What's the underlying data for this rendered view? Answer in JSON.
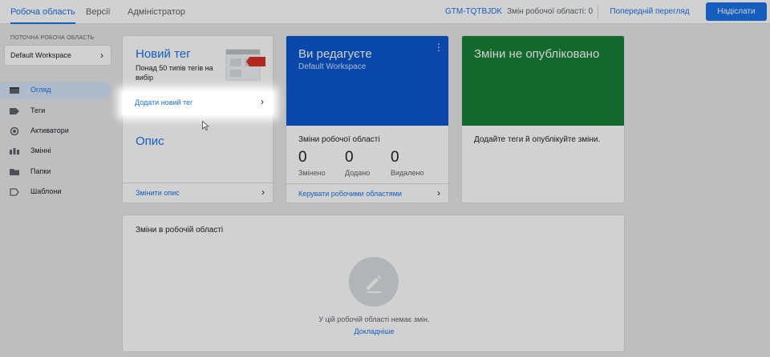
{
  "topbar": {
    "tabs": [
      "Робоча область",
      "Версії",
      "Адміністратор"
    ],
    "container_id": "GTM-TQTBJDK",
    "ws_changes": "Змін робочої області: 0",
    "preview_label": "Попередній перегляд",
    "submit_label": "Надіслати"
  },
  "sidebar": {
    "ws_label": "ПОТОЧНА РОБОЧА ОБЛАСТЬ",
    "ws_name": "Default Workspace",
    "items": [
      "Огляд",
      "Теги",
      "Активатори",
      "Змінні",
      "Папки",
      "Шаблони"
    ]
  },
  "new_tag": {
    "title": "Новий тег",
    "desc": "Понад 50 типів тегів на вибір",
    "add_label": "Додати новий тег"
  },
  "description": {
    "title": "Опис",
    "edit_label": "Змінити опис"
  },
  "editing": {
    "title": "Ви редагуєте",
    "workspace": "Default Workspace",
    "changes_title": "Зміни робочої області",
    "stats": [
      {
        "value": "0",
        "label": "Змінено"
      },
      {
        "value": "0",
        "label": "Додано"
      },
      {
        "value": "0",
        "label": "Видалено"
      }
    ],
    "manage_label": "Керувати робочими областями"
  },
  "unpublished": {
    "title": "Зміни не опубліковано",
    "text": "Додайте теги й опублікуйте зміни."
  },
  "ws_changes_panel": {
    "title": "Зміни в робочій області",
    "empty_text": "У цій робочій області немає змін.",
    "learn_more": "Докладніше"
  },
  "colors": {
    "accent": "#1a73e8",
    "edit_card": "#0b57d0",
    "unpublished_card": "#188038"
  }
}
